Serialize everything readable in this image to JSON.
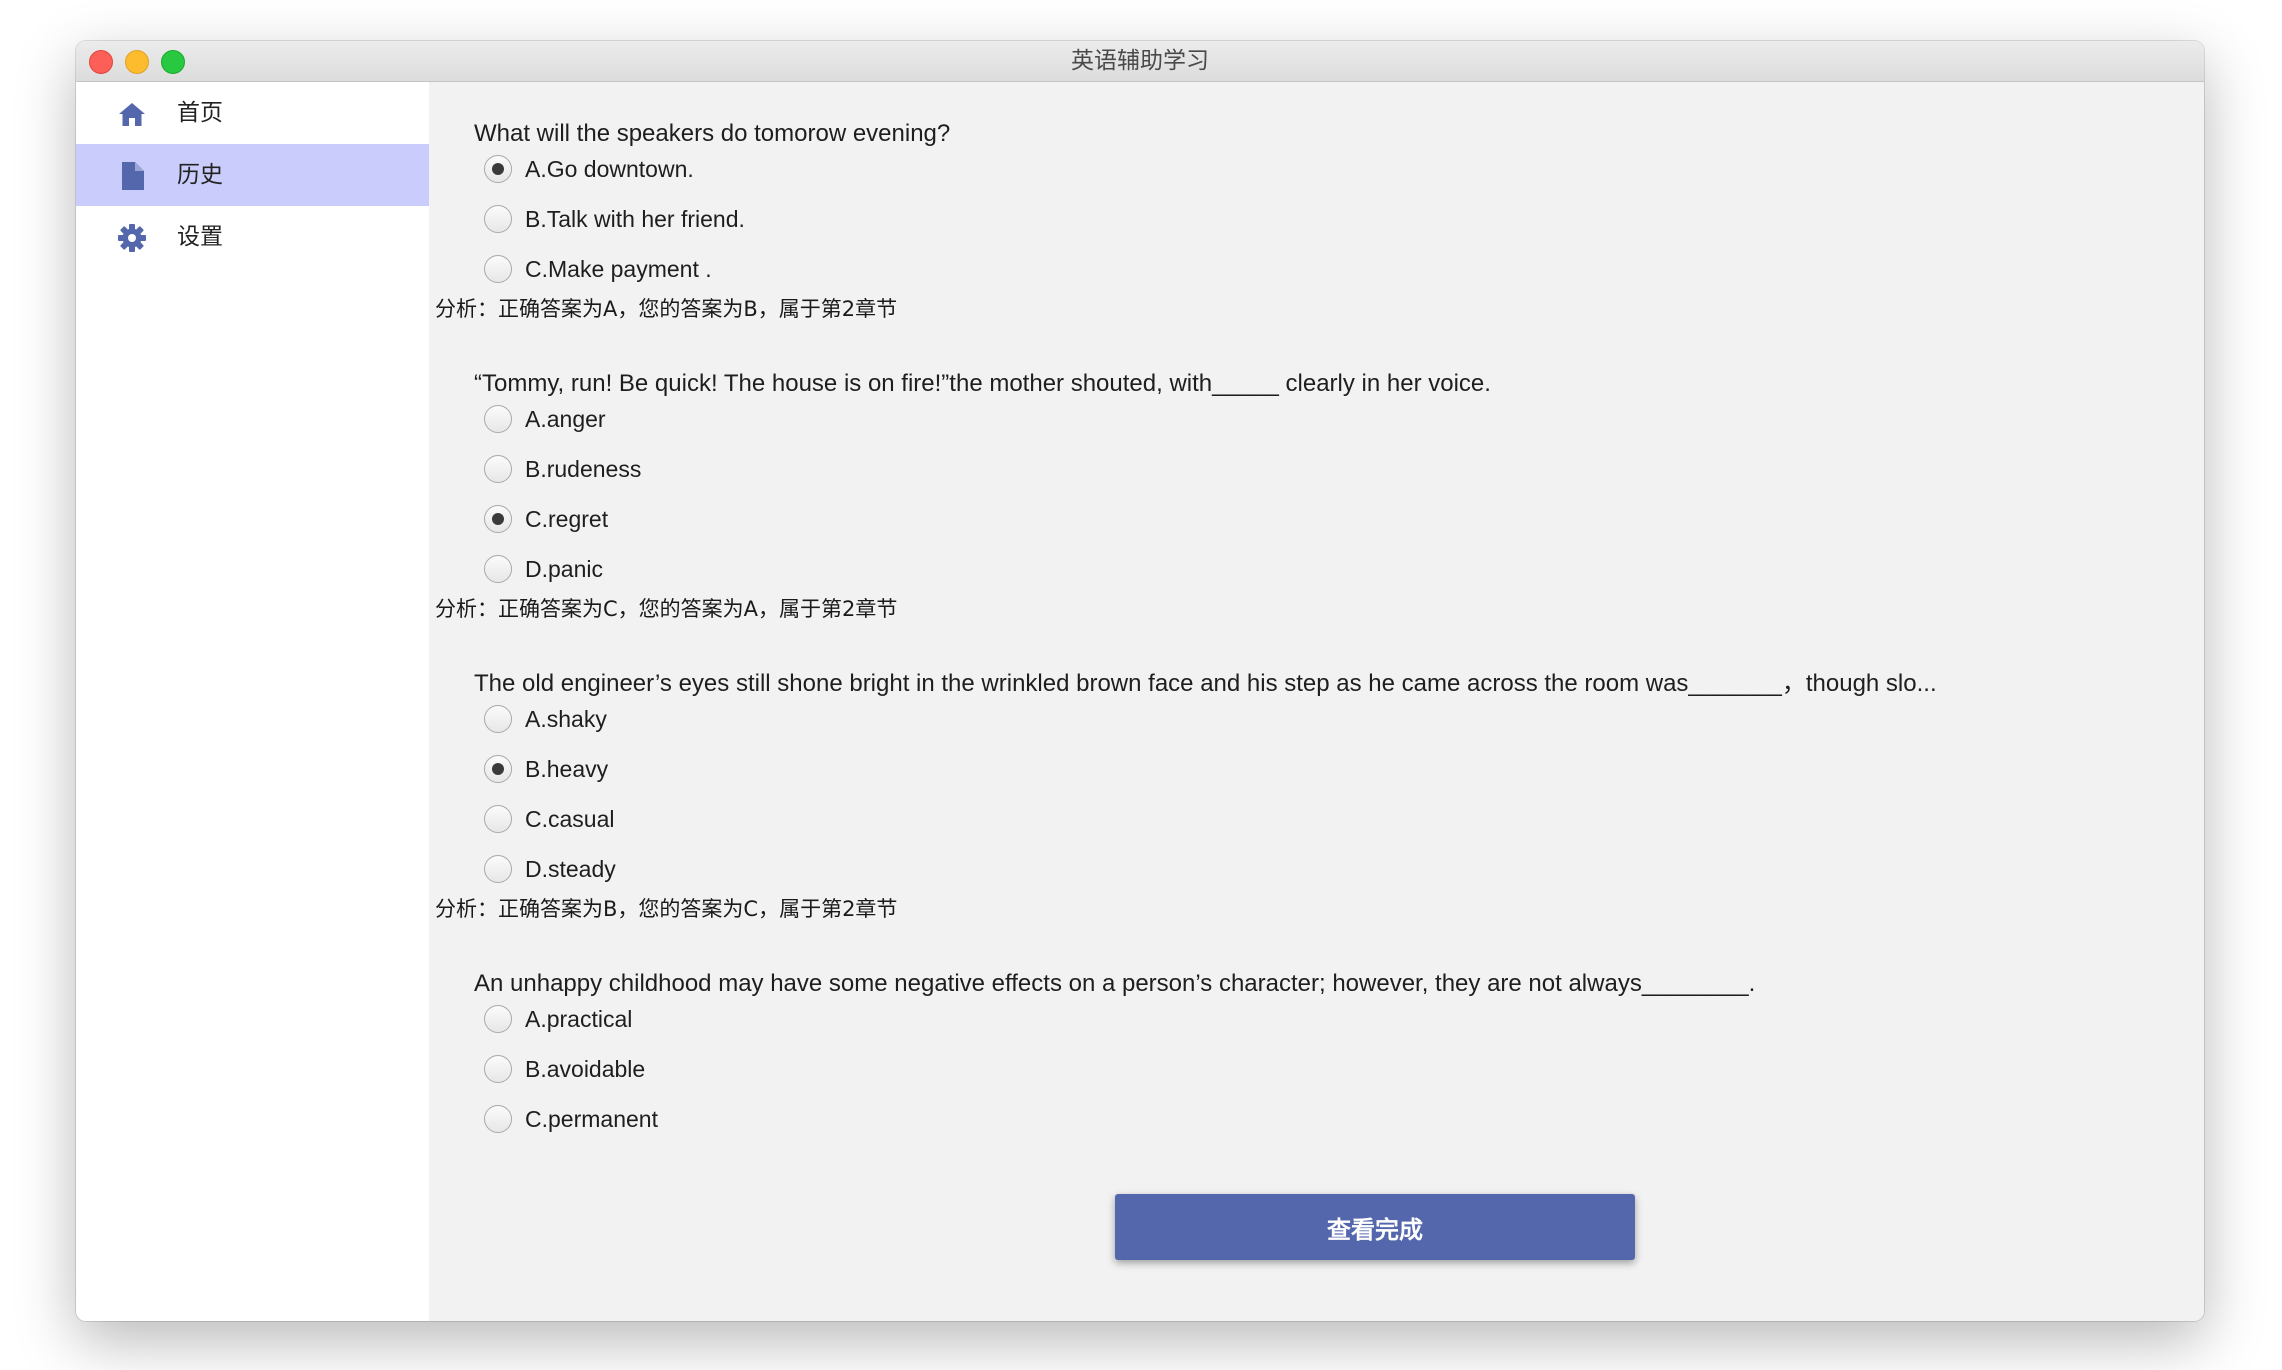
{
  "window": {
    "title": "英语辅助学习"
  },
  "sidebar": {
    "items": [
      {
        "label": "首页",
        "icon": "home-icon",
        "active": false
      },
      {
        "label": "历史",
        "icon": "document-icon",
        "active": true
      },
      {
        "label": "设置",
        "icon": "gear-icon",
        "active": false
      }
    ]
  },
  "questions": [
    {
      "text": "What will the speakers do tomorow evening?",
      "options": [
        {
          "label": "A.Go downtown.",
          "checked": true
        },
        {
          "label": "B.Talk with her friend.",
          "checked": false
        },
        {
          "label": "C.Make payment .",
          "checked": false
        }
      ],
      "analysis": "分析：正确答案为A，您的答案为B，属于第2章节"
    },
    {
      "text": "“Tommy, run! Be quick! The house is on fire!”the mother shouted, with_____ clearly in her voice.",
      "options": [
        {
          "label": "A.anger",
          "checked": false
        },
        {
          "label": "B.rudeness",
          "checked": false
        },
        {
          "label": "C.regret",
          "checked": true
        },
        {
          "label": "D.panic",
          "checked": false
        }
      ],
      "analysis": "分析：正确答案为C，您的答案为A，属于第2章节"
    },
    {
      "text": "The old engineer’s eyes still shone bright in the wrinkled brown face and his step as he came across the room was_______，though slo...",
      "options": [
        {
          "label": "A.shaky",
          "checked": false
        },
        {
          "label": "B.heavy",
          "checked": true
        },
        {
          "label": "C.casual",
          "checked": false
        },
        {
          "label": "D.steady",
          "checked": false
        }
      ],
      "analysis": "分析：正确答案为B，您的答案为C，属于第2章节"
    },
    {
      "text": "An unhappy childhood may have some negative effects on a person’s character; however, they are not always________.",
      "options": [
        {
          "label": "A.practical",
          "checked": false
        },
        {
          "label": "B.avoidable",
          "checked": false
        },
        {
          "label": "C.permanent",
          "checked": false
        }
      ],
      "analysis": ""
    }
  ],
  "footer": {
    "done_label": "查看完成"
  },
  "colors": {
    "accent": "#5467ad",
    "sidebar_active": "#cacdfb"
  }
}
